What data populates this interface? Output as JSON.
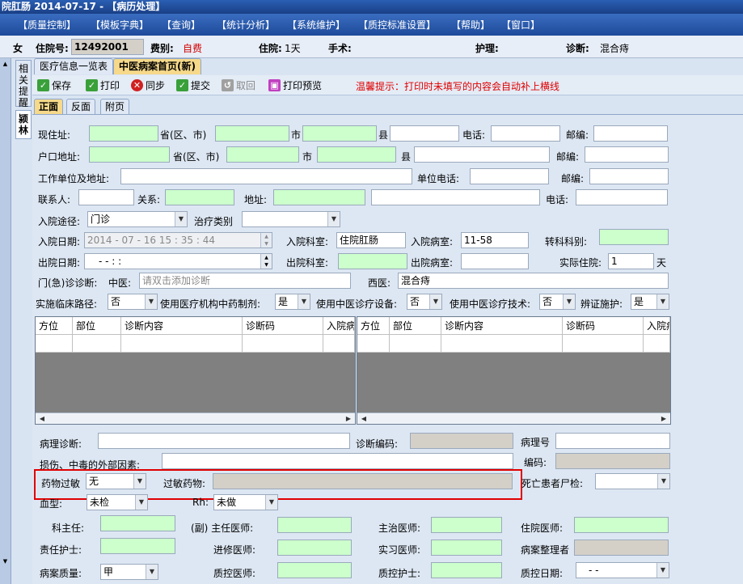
{
  "window": {
    "title": "院肛肠  2014-07-17 - 【病历处理】"
  },
  "menu": [
    "【质量控制】",
    "【模板字典】",
    "【查询】",
    "【统计分析】",
    "【系统维护】",
    "【质控标准设置】",
    "【帮助】",
    "【窗口】"
  ],
  "patient": {
    "gender": "女",
    "admission_no_label": "住院号:",
    "admission_no": "12492001",
    "fee_type_label": "费别:",
    "fee_type": "自费",
    "stay_label": "住院:",
    "stay": "1天",
    "surgery_label": "手术:",
    "nursing_label": "护理:",
    "diagnosis_label": "诊断:",
    "diagnosis": "混合痔"
  },
  "left_tabs": [
    "相关提醒",
    "颍林"
  ],
  "top_tabs": [
    "医疗信息一览表",
    "中医病案首页(新)"
  ],
  "toolbar": {
    "save": "保存",
    "print": "打印",
    "sync": "同步",
    "submit": "提交",
    "retract": "取回",
    "print_preview": "打印预览",
    "tip": "温馨提示：打印时未填写的内容会自动补上横线"
  },
  "sub_tabs": [
    "正面",
    "反面",
    "附页"
  ],
  "form": {
    "current_address": "现住址:",
    "province": "省(区、市)",
    "city": "市",
    "county": "县",
    "phone": "电话:",
    "zip": "邮编:",
    "household_address": "户口地址:",
    "work_unit": "工作单位及地址:",
    "unit_phone": "单位电话:",
    "contact": "联系人:",
    "relation": "关系:",
    "address": "地址:",
    "admission_route": "入院途径:",
    "admission_route_value": "门诊",
    "treatment_type": "治疗类别",
    "admission_date": "入院日期:",
    "admission_date_value": "2014 - 07 - 16   15 : 35 : 44",
    "admission_dept": "入院科室:",
    "admission_dept_value": "住院肛肠",
    "admission_ward": "入院病室:",
    "admission_ward_value": "11-58",
    "transfer_dept": "转科科别:",
    "discharge_date": "出院日期:",
    "discharge_date_value": "-   -        :   :",
    "discharge_dept": "出院科室:",
    "discharge_ward": "出院病室:",
    "actual_stay": "实际住院:",
    "actual_stay_value": "1",
    "day_unit": "天",
    "outpatient_diag": "门(急)诊诊断:",
    "tcm_label": "中医:",
    "tcm_placeholder": "请双击添加诊断",
    "western_label": "西医:",
    "western_value": "混合痔",
    "clinical_path": "实施临床路径:",
    "clinical_path_value": "否",
    "use_tcm_prep": "使用医疗机构中药制剂:",
    "use_tcm_prep_value": "是",
    "use_tcm_device": "使用中医诊疗设备:",
    "use_tcm_device_value": "否",
    "use_tcm_tech": "使用中医诊疗技术:",
    "use_tcm_tech_value": "否",
    "syndrome": "辨证施护:",
    "syndrome_value": "是",
    "pathology_diag": "病理诊断:",
    "diag_code": "诊断编码:",
    "pathology_no": "病理号",
    "injury_cause": "损伤、中毒的外部因素:",
    "code": "编码:",
    "drug_allergy": "药物过敏",
    "drug_allergy_value": "无",
    "allergy_drug": "过敏药物:",
    "autopsy": "死亡患者尸检:",
    "blood_type": "血型:",
    "blood_type_value": "未检",
    "rh": "Rh:",
    "rh_value": "未做",
    "dept_head": "科主任:",
    "chief_physician": "(副) 主任医师:",
    "attending": "主治医师:",
    "resident": "住院医师:",
    "nurse": "责任护士:",
    "refresher": "进修医师:",
    "intern": "实习医师:",
    "organizer": "病案整理者",
    "record_quality": "病案质量:",
    "record_quality_value": "甲",
    "qc_doctor": "质控医师:",
    "qc_nurse": "质控护士:",
    "qc_date": "质控日期:",
    "qc_date_value": "-   -"
  },
  "grid_headers": [
    "方位",
    "部位",
    "诊断内容",
    "诊断码",
    "入院病"
  ]
}
